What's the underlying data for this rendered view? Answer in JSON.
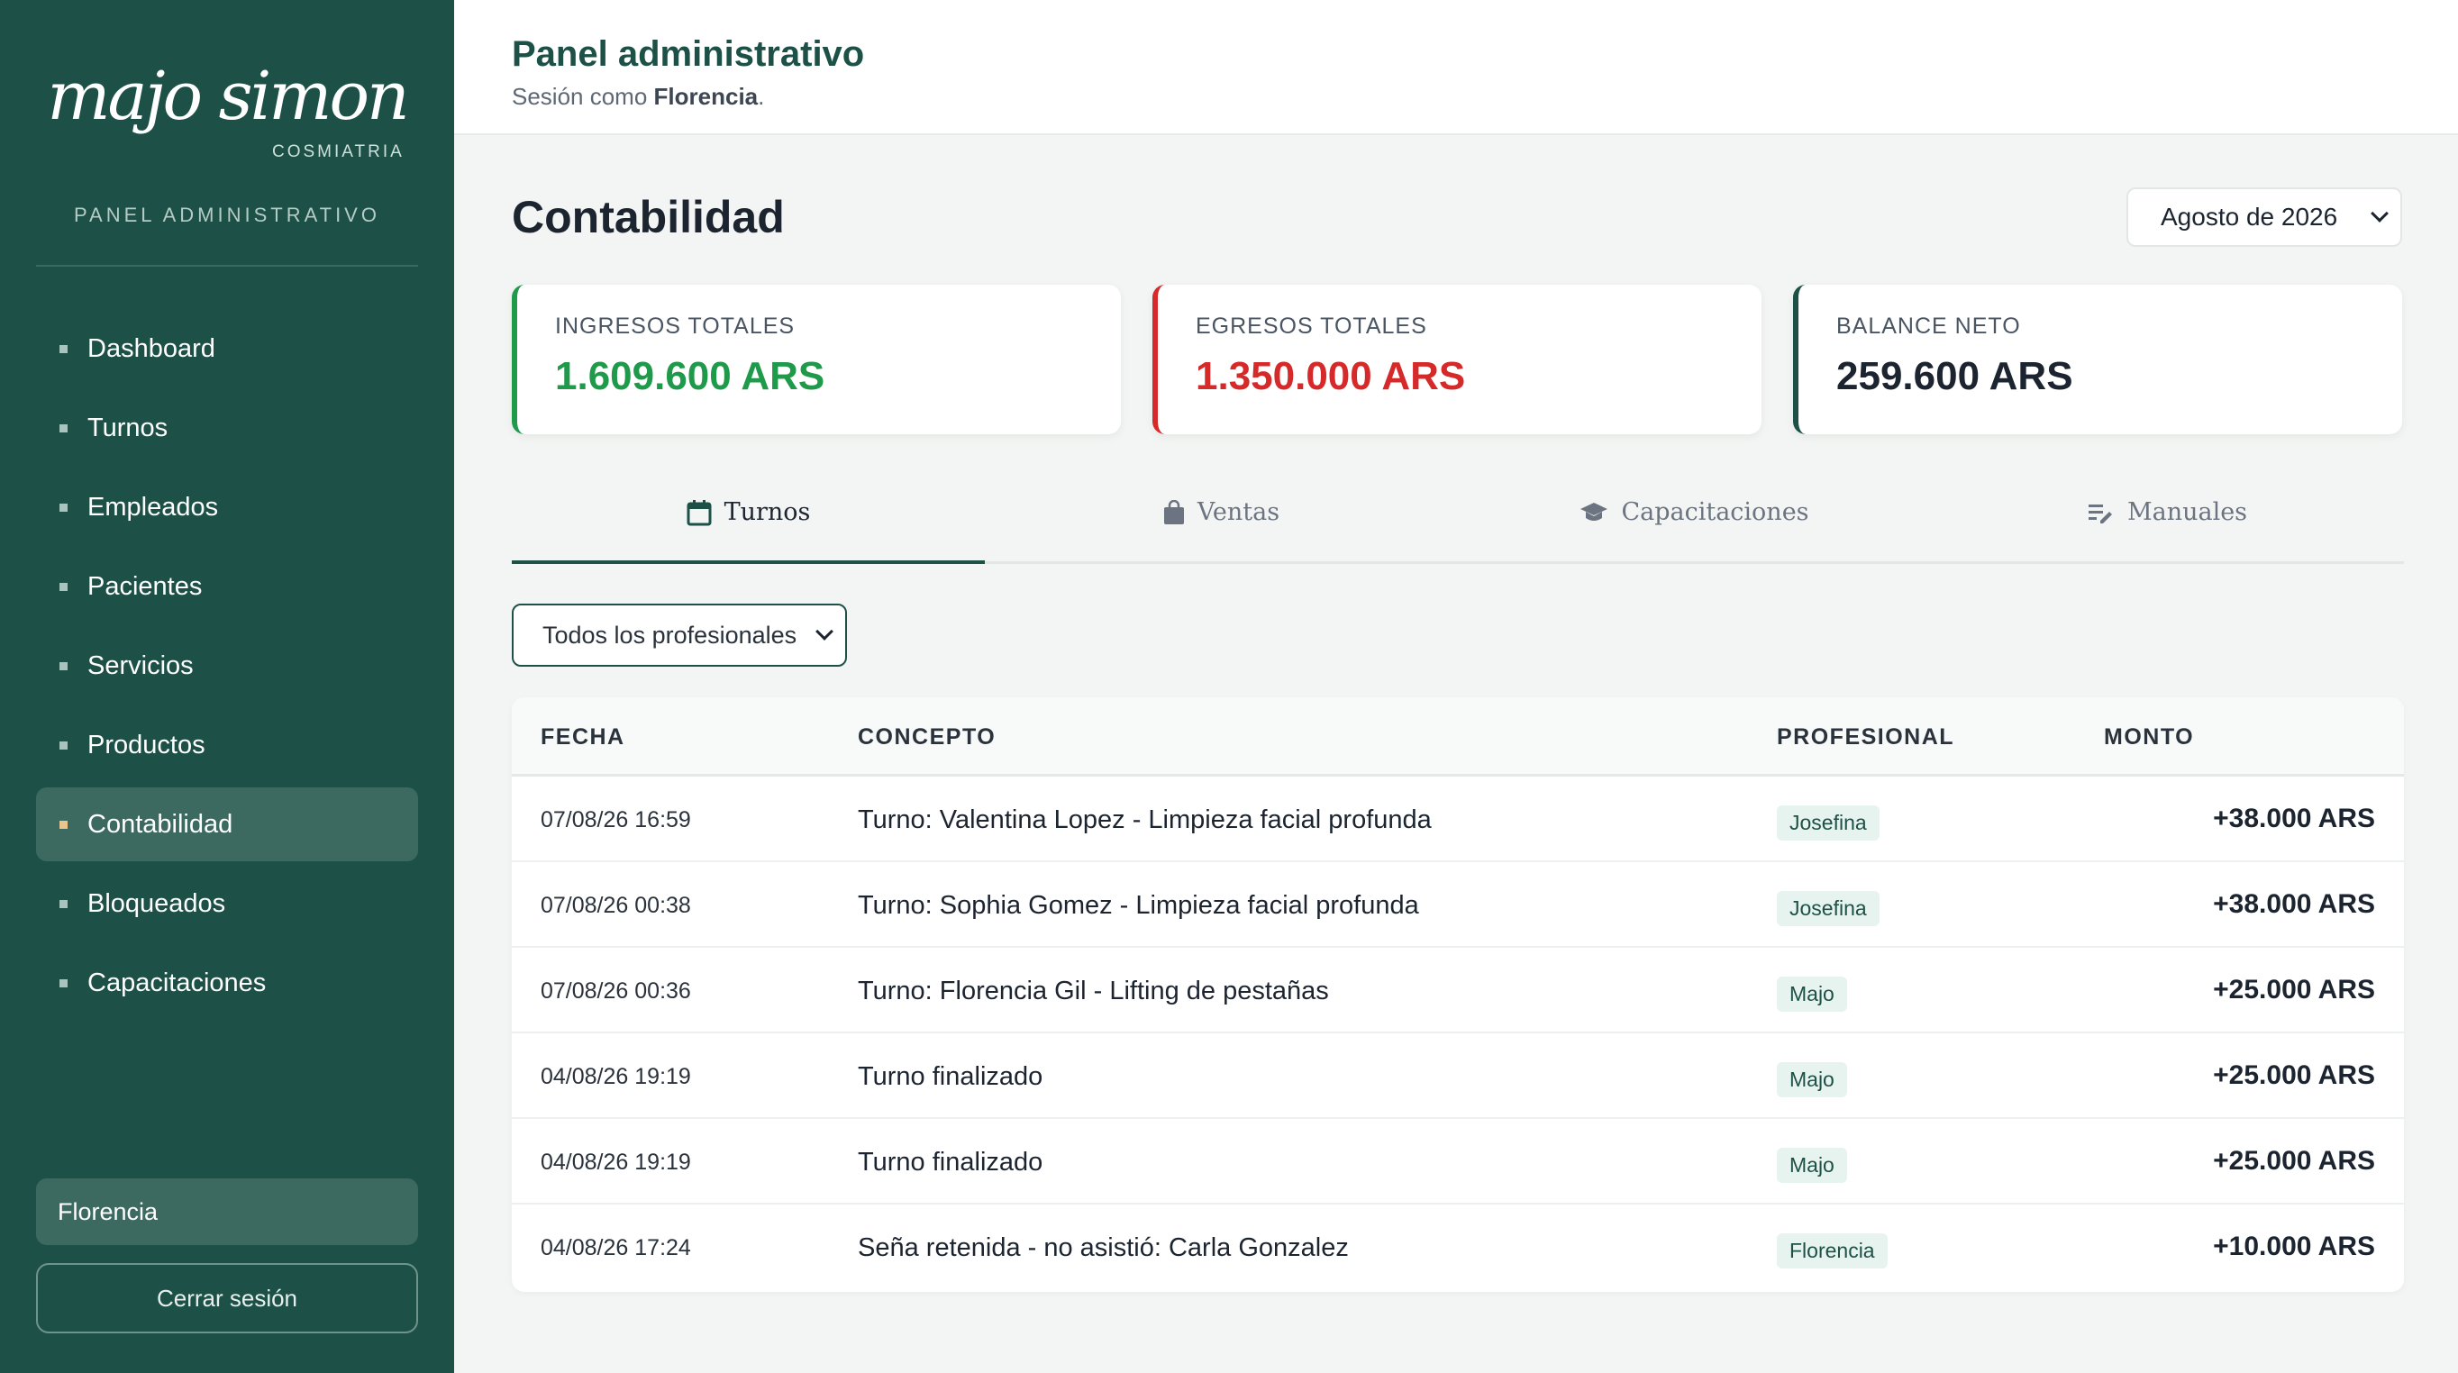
{
  "sidebar": {
    "brand_name": "majo simon",
    "brand_sub": "COSMIATRIA",
    "panel_label": "PANEL ADMINISTRATIVO",
    "items": [
      {
        "label": "Dashboard"
      },
      {
        "label": "Turnos"
      },
      {
        "label": "Empleados"
      },
      {
        "label": "Pacientes"
      },
      {
        "label": "Servicios"
      },
      {
        "label": "Productos"
      },
      {
        "label": "Contabilidad"
      },
      {
        "label": "Bloqueados"
      },
      {
        "label": "Capacitaciones"
      }
    ],
    "active_item": "Contabilidad",
    "user_name": "Florencia",
    "logout_label": "Cerrar sesión"
  },
  "header": {
    "title": "Panel administrativo",
    "session_prefix": "Sesión como ",
    "session_user": "Florencia",
    "session_suffix": "."
  },
  "main": {
    "title": "Contabilidad",
    "month_select": "Agosto de 2026",
    "cards": {
      "income": {
        "label": "INGRESOS TOTALES",
        "value": "1.609.600 ARS",
        "color": "#1f9a4b"
      },
      "expense": {
        "label": "EGRESOS TOTALES",
        "value": "1.350.000 ARS",
        "color": "#d62a2a"
      },
      "balance": {
        "label": "BALANCE NETO",
        "value": "259.600 ARS",
        "color": "#1d5147"
      }
    },
    "tabs": [
      {
        "label": "Turnos",
        "icon": "calendar-icon",
        "active": true
      },
      {
        "label": "Ventas",
        "icon": "shopping-bag-icon",
        "active": false
      },
      {
        "label": "Capacitaciones",
        "icon": "graduation-cap-icon",
        "active": false
      },
      {
        "label": "Manuales",
        "icon": "edit-list-icon",
        "active": false
      }
    ],
    "professional_select": "Todos los profesionales",
    "table": {
      "headers": {
        "date": "FECHA",
        "concept": "CONCEPTO",
        "professional": "PROFESIONAL",
        "amount": "MONTO"
      },
      "rows": [
        {
          "date": "07/08/26 16:59",
          "concept": "Turno: Valentina Lopez - Limpieza facial profunda",
          "professional": "Josefina",
          "amount": "+38.000 ARS"
        },
        {
          "date": "07/08/26 00:38",
          "concept": "Turno: Sophia Gomez - Limpieza facial profunda",
          "professional": "Josefina",
          "amount": "+38.000 ARS"
        },
        {
          "date": "07/08/26 00:36",
          "concept": "Turno: Florencia Gil - Lifting de pestañas",
          "professional": "Majo",
          "amount": "+25.000 ARS"
        },
        {
          "date": "04/08/26 19:19",
          "concept": "Turno finalizado",
          "professional": "Majo",
          "amount": "+25.000 ARS"
        },
        {
          "date": "04/08/26 19:19",
          "concept": "Turno finalizado",
          "professional": "Majo",
          "amount": "+25.000 ARS"
        },
        {
          "date": "04/08/26 17:24",
          "concept": "Seña retenida - no asistió: Carla Gonzalez",
          "professional": "Florencia",
          "amount": "+10.000 ARS"
        }
      ]
    }
  },
  "colors": {
    "sidebar_bg": "#1d5147",
    "accent": "#1d5147",
    "income": "#1f9a4b",
    "expense": "#d62a2a"
  }
}
